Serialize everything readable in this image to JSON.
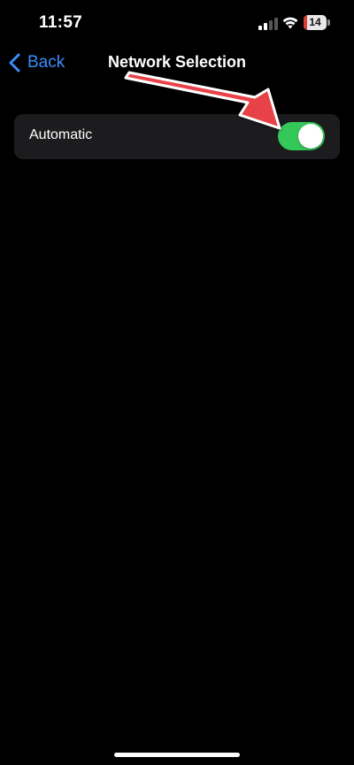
{
  "status_bar": {
    "time": "11:57",
    "battery_level": "14",
    "battery_fraction": 0.14,
    "signal_bars_active": 2,
    "signal_bars_total": 4,
    "icons": [
      "cellular-signal-icon",
      "wifi-icon",
      "battery-icon"
    ]
  },
  "nav": {
    "back_label": "Back",
    "title": "Network Selection"
  },
  "settings": {
    "rows": [
      {
        "label": "Automatic",
        "toggle_on": true
      }
    ]
  },
  "annotation": {
    "type": "red-arrow",
    "color": "#e8434a",
    "outline_color": "#ffffff",
    "points_to": "automatic-toggle"
  },
  "colors": {
    "background": "#000000",
    "group_background": "#1c1c1e",
    "accent_blue": "#3a8dfb",
    "toggle_on": "#34c759",
    "battery_low": "#e03b35"
  }
}
